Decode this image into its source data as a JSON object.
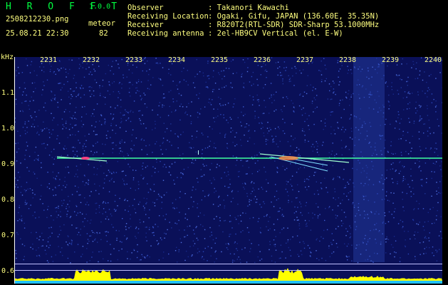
{
  "app": {
    "title": "H R O F F T",
    "version": "1.0.0"
  },
  "file": {
    "name": "2508212230.png",
    "datetime": "25.08.21 22:30"
  },
  "meteor": {
    "label": "meteor",
    "count": "82"
  },
  "info": {
    "observer_label": "Observer",
    "observer_value": ": Takanori Kawachi",
    "location_label": "Receiving Location",
    "location_value": ": Ogaki, Gifu, JAPAN (136.60E, 35.35N)",
    "receiver_label": "Receiver",
    "receiver_value": ": R820T2(RTL-SDR) SDR-Sharp 53.1000MHz",
    "antenna_label": "Receiving antenna",
    "antenna_value": ": 2el-HB9CV Vertical (el. E-W)"
  },
  "axes": {
    "y_unit": "kHz",
    "y_ticks": [
      "1.1",
      "1.0",
      "0.9",
      "0.8",
      "0.7",
      "0.6"
    ],
    "x_ticks": [
      "2231",
      "2232",
      "2233",
      "2234",
      "2235",
      "2236",
      "2237",
      "2238",
      "2239",
      "2240"
    ]
  },
  "colors": {
    "background": "#000000",
    "label": "#ffff80",
    "title": "#00ff40",
    "spectrogram_base": "#0a1058",
    "signal_line": "#40ffa0",
    "histogram": "#ffff00",
    "baseline": "#20c0ff"
  }
}
